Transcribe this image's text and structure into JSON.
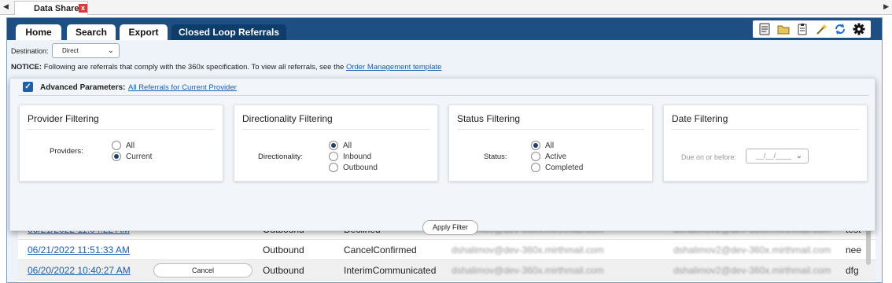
{
  "doc_tab": {
    "title": "Data Share",
    "close": "x"
  },
  "nav": {
    "tabs": [
      "Home",
      "Search",
      "Export",
      "Closed Loop Referrals"
    ]
  },
  "destination": {
    "label": "Destination:",
    "value": "Direct"
  },
  "notice": {
    "bold": "NOTICE:",
    "text": " Following are referrals that comply with the 360x specification. To view all referrals, see the ",
    "link": "Order Management template"
  },
  "advanced": {
    "checked": true,
    "label": "Advanced Parameters:",
    "link": "All Referrals for Current Provider"
  },
  "provider": {
    "title": "Provider Filtering",
    "label": "Providers:",
    "options": [
      "All",
      "Current"
    ],
    "selected": "Current"
  },
  "direction": {
    "title": "Directionality Filtering",
    "label": "Directionality:",
    "options": [
      "All",
      "Inbound",
      "Outbound"
    ],
    "selected": "All"
  },
  "status": {
    "title": "Status Filtering",
    "label": "Status:",
    "options": [
      "All",
      "Active",
      "Completed"
    ],
    "selected": "All"
  },
  "date": {
    "title": "Date Filtering",
    "label": "Due on or before:",
    "placeholder": "__/__/____"
  },
  "apply_label": "Apply Filter",
  "rows": [
    {
      "date": "06/21/2022 11:04:22 AM",
      "direction": "Outbound",
      "status": "Declined",
      "from": "dshalimov@dev-360x.mirthmail.com",
      "to": "dshalimov2@dev-360x.mirthmail.com",
      "note": "test"
    },
    {
      "date": "06/21/2022 11:51:33 AM",
      "direction": "Outbound",
      "status": "CancelConfirmed",
      "from": "dshalimov@dev-360x.mirthmail.com",
      "to": "dshalimov2@dev-360x.mirthmail.com",
      "note": "nee"
    },
    {
      "date": "06/20/2022 10:40:27 AM",
      "direction": "Outbound",
      "status": "InterimCommunicated",
      "from": "dshalimov@dev-360x.mirthmail.com",
      "to": "dshalimov2@dev-360x.mirthmail.com",
      "note": "dfg",
      "action": "Cancel"
    }
  ]
}
